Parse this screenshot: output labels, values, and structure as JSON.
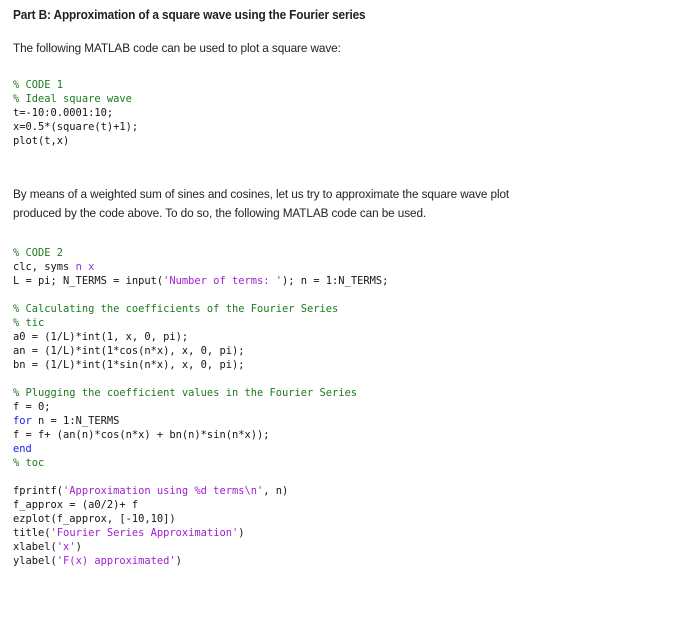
{
  "document": {
    "heading": "Part B: Approximation of a square wave using the Fourier series",
    "paragraph_1_lines": [
      "The following MATLAB code can be used to plot a square wave:"
    ],
    "paragraph_2_lines": [
      "By means of a weighted sum of sines and cosines, let us try to approximate the square wave plot",
      "produced by the code above. To do so, the following MATLAB code can be used."
    ]
  },
  "colors": {
    "text": "#231f20",
    "comment_green": "#1d7a1d",
    "string_purple": "#a020d0",
    "keyword_blue": "#1a1ae6",
    "symbol_purple": "#9b30d9",
    "background": "#ffffff"
  },
  "code_1": {
    "title": "% CODE 1",
    "lines": [
      [
        {
          "t": "% CODE 1",
          "c": "cmt"
        }
      ],
      [
        {
          "t": "% Ideal square wave",
          "c": "cmt"
        }
      ],
      [
        {
          "t": "t=-10:0.0001:10;",
          "c": ""
        }
      ],
      [
        {
          "t": "x=0.5*(square(t)+1);",
          "c": ""
        }
      ],
      [
        {
          "t": "plot(t,x)",
          "c": ""
        }
      ]
    ]
  },
  "code_2": {
    "title": "% CODE 2",
    "lines": [
      [
        {
          "t": "% CODE 2",
          "c": "cmt"
        }
      ],
      [
        {
          "t": "clc, syms ",
          "c": ""
        },
        {
          "t": "n x",
          "c": "sym"
        }
      ],
      [
        {
          "t": "L = pi; N_TERMS = input(",
          "c": ""
        },
        {
          "t": "'Number of terms: '",
          "c": "str"
        },
        {
          "t": "); n = 1:N_TERMS;",
          "c": ""
        }
      ],
      [
        {
          "t": "",
          "c": ""
        }
      ],
      [
        {
          "t": "% Calculating the coefficients of the Fourier Series",
          "c": "cmt"
        }
      ],
      [
        {
          "t": "% tic",
          "c": "cmt"
        }
      ],
      [
        {
          "t": "a0 = (1/L)*int(1, x, 0, pi);",
          "c": ""
        }
      ],
      [
        {
          "t": "an = (1/L)*int(1*cos(n*x), x, 0, pi);",
          "c": ""
        }
      ],
      [
        {
          "t": "bn = (1/L)*int(1*sin(n*x), x, 0, pi);",
          "c": ""
        }
      ],
      [
        {
          "t": "",
          "c": ""
        }
      ],
      [
        {
          "t": "% Plugging the coefficient values in the Fourier Series",
          "c": "cmt"
        }
      ],
      [
        {
          "t": "f = 0;",
          "c": ""
        }
      ],
      [
        {
          "t": "for",
          "c": "kw"
        },
        {
          "t": " n = 1:N_TERMS",
          "c": ""
        }
      ],
      [
        {
          "t": "f = f+ (an(n)*cos(n*x) + bn(n)*sin(n*x));",
          "c": ""
        }
      ],
      [
        {
          "t": "end",
          "c": "kw"
        }
      ],
      [
        {
          "t": "% toc",
          "c": "cmt"
        }
      ],
      [
        {
          "t": "",
          "c": ""
        }
      ],
      [
        {
          "t": "fprintf(",
          "c": ""
        },
        {
          "t": "'Approximation using %d terms\\n'",
          "c": "str"
        },
        {
          "t": ", n)",
          "c": ""
        }
      ],
      [
        {
          "t": "f_approx = (a0/2)+ f",
          "c": ""
        }
      ],
      [
        {
          "t": "ezplot(f_approx, [-10,10])",
          "c": ""
        }
      ],
      [
        {
          "t": "title(",
          "c": ""
        },
        {
          "t": "'Fourier Series Approximation'",
          "c": "str"
        },
        {
          "t": ")",
          "c": ""
        }
      ],
      [
        {
          "t": "xlabel(",
          "c": ""
        },
        {
          "t": "'x'",
          "c": "str"
        },
        {
          "t": ")",
          "c": ""
        }
      ],
      [
        {
          "t": "ylabel(",
          "c": ""
        },
        {
          "t": "'F(x) approximated'",
          "c": "str"
        },
        {
          "t": ")",
          "c": ""
        }
      ]
    ]
  }
}
